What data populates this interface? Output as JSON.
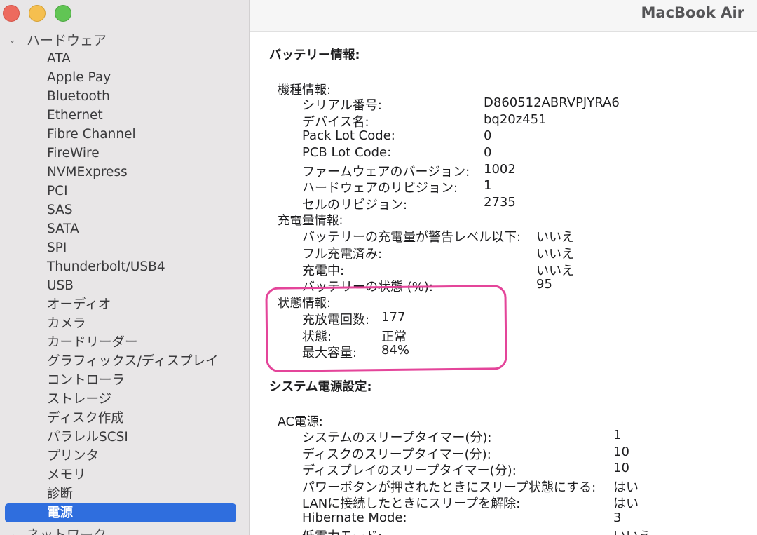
{
  "window": {
    "title": "MacBook Air"
  },
  "sidebar": {
    "section": "ハードウェア",
    "items": [
      {
        "label": "ATA"
      },
      {
        "label": "Apple Pay"
      },
      {
        "label": "Bluetooth"
      },
      {
        "label": "Ethernet"
      },
      {
        "label": "Fibre Channel"
      },
      {
        "label": "FireWire"
      },
      {
        "label": "NVMExpress"
      },
      {
        "label": "PCI"
      },
      {
        "label": "SAS"
      },
      {
        "label": "SATA"
      },
      {
        "label": "SPI"
      },
      {
        "label": "Thunderbolt/USB4"
      },
      {
        "label": "USB"
      },
      {
        "label": "オーディオ"
      },
      {
        "label": "カメラ"
      },
      {
        "label": "カードリーダー"
      },
      {
        "label": "グラフィックス/ディスプレイ"
      },
      {
        "label": "コントローラ"
      },
      {
        "label": "ストレージ"
      },
      {
        "label": "ディスク作成"
      },
      {
        "label": "パラレルSCSI"
      },
      {
        "label": "プリンタ"
      },
      {
        "label": "メモリ"
      },
      {
        "label": "診断"
      },
      {
        "label": "電源",
        "selected": true
      }
    ],
    "next_section": "ネットワーク"
  },
  "battery": {
    "heading": "バッテリー情報:",
    "model": {
      "label": "機種情報:",
      "rows": [
        {
          "key": "シリアル番号:",
          "value": "D860512ABRVPJYRA6"
        },
        {
          "key": "デバイス名:",
          "value": "bq20z451"
        },
        {
          "key": "Pack Lot Code:",
          "value": "0"
        },
        {
          "key": "PCB Lot Code:",
          "value": "0"
        },
        {
          "key": "ファームウェアのバージョン:",
          "value": "1002"
        },
        {
          "key": "ハードウェアのリビジョン:",
          "value": "1"
        },
        {
          "key": "セルのリビジョン:",
          "value": "2735"
        }
      ]
    },
    "charge": {
      "label": "充電量情報:",
      "rows": [
        {
          "key": "バッテリーの充電量が警告レベル以下:",
          "value": "いいえ"
        },
        {
          "key": "フル充電済み:",
          "value": "いいえ"
        },
        {
          "key": "充電中:",
          "value": "いいえ"
        },
        {
          "key": "バッテリーの状態 (%):",
          "value": "95"
        }
      ]
    },
    "health": {
      "label": "状態情報:",
      "rows": [
        {
          "key": "充放電回数:",
          "value": "177"
        },
        {
          "key": "状態:",
          "value": "正常"
        },
        {
          "key": "最大容量:",
          "value": "84%"
        }
      ]
    }
  },
  "power": {
    "heading": "システム電源設定:",
    "ac": {
      "label": "AC電源:",
      "rows": [
        {
          "key": "システムのスリープタイマー(分):",
          "value": "1"
        },
        {
          "key": "ディスクのスリープタイマー(分):",
          "value": "10"
        },
        {
          "key": "ディスプレイのスリープタイマー(分):",
          "value": "10"
        },
        {
          "key": "パワーボタンが押されたときにスリープ状態にする:",
          "value": "はい"
        },
        {
          "key": "LANに接続したときにスリープを解除:",
          "value": "はい"
        },
        {
          "key": "Hibernate Mode:",
          "value": "3"
        },
        {
          "key": "低電力モード:",
          "value": "いいえ"
        }
      ]
    }
  },
  "colors": {
    "selection": "#2f6ede",
    "highlight_marker": "#e4459a",
    "sidebar_bg": "#e8e6e7"
  }
}
